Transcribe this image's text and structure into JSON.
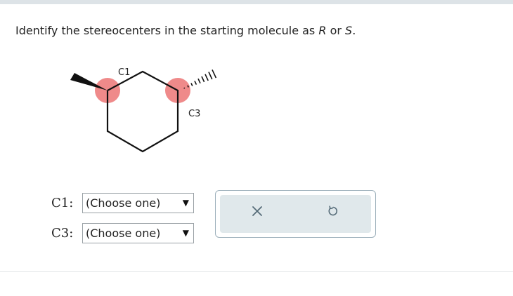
{
  "question": {
    "prefix": "Identify the stereocenters in the starting molecule as",
    "option_r": "R",
    "conjunction": "or",
    "option_s": "S",
    "end": "."
  },
  "molecule": {
    "labels": {
      "c1": "C1",
      "c3": "C3"
    },
    "highlight_color": "#ef8a8a"
  },
  "answers": [
    {
      "label": "C1:",
      "selected": "(Choose one)"
    },
    {
      "label": "C3:",
      "selected": "(Choose one)"
    }
  ],
  "tools": {
    "clear_icon": "x-icon",
    "reset_icon": "undo-icon"
  }
}
